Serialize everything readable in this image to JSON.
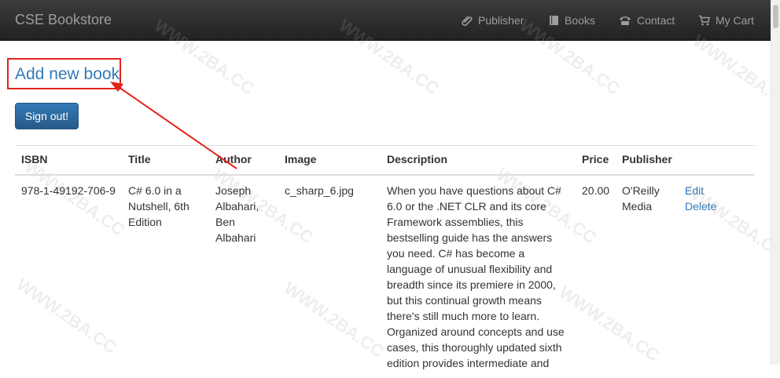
{
  "navbar": {
    "brand": "CSE Bookstore",
    "items": [
      {
        "label": "Publisher",
        "icon": "paperclip-icon"
      },
      {
        "label": "Books",
        "icon": "book-icon"
      },
      {
        "label": "Contact",
        "icon": "phone-icon"
      },
      {
        "label": "My Cart",
        "icon": "shopping-cart-icon"
      }
    ]
  },
  "main": {
    "add_link": "Add new book",
    "signout_label": "Sign out!"
  },
  "table": {
    "headers": [
      "ISBN",
      "Title",
      "Author",
      "Image",
      "Description",
      "Price",
      "Publisher",
      ""
    ],
    "rows": [
      {
        "isbn": "978-1-49192-706-9",
        "title": "C# 6.0 in a Nutshell, 6th Edition",
        "author": "Joseph Albahari, Ben Albahari",
        "image": "c_sharp_6.jpg",
        "description": "When you have questions about C# 6.0 or the .NET CLR and its core Framework assemblies, this bestselling guide has the answers you need. C# has become a language of unusual flexibility and breadth since its premiere in 2000, but this continual growth means there's still much more to learn. Organized around concepts and use cases, this thoroughly updated sixth edition provides intermediate and",
        "price": "20.00",
        "publisher": "O'Reilly Media",
        "edit_label": "Edit",
        "delete_label": "Delete"
      }
    ]
  },
  "watermark": "WWW.2BA.CC",
  "colors": {
    "navbar": "#222222",
    "link": "#337ab7",
    "button": "#337ab7",
    "annotation": "#e2231a"
  }
}
